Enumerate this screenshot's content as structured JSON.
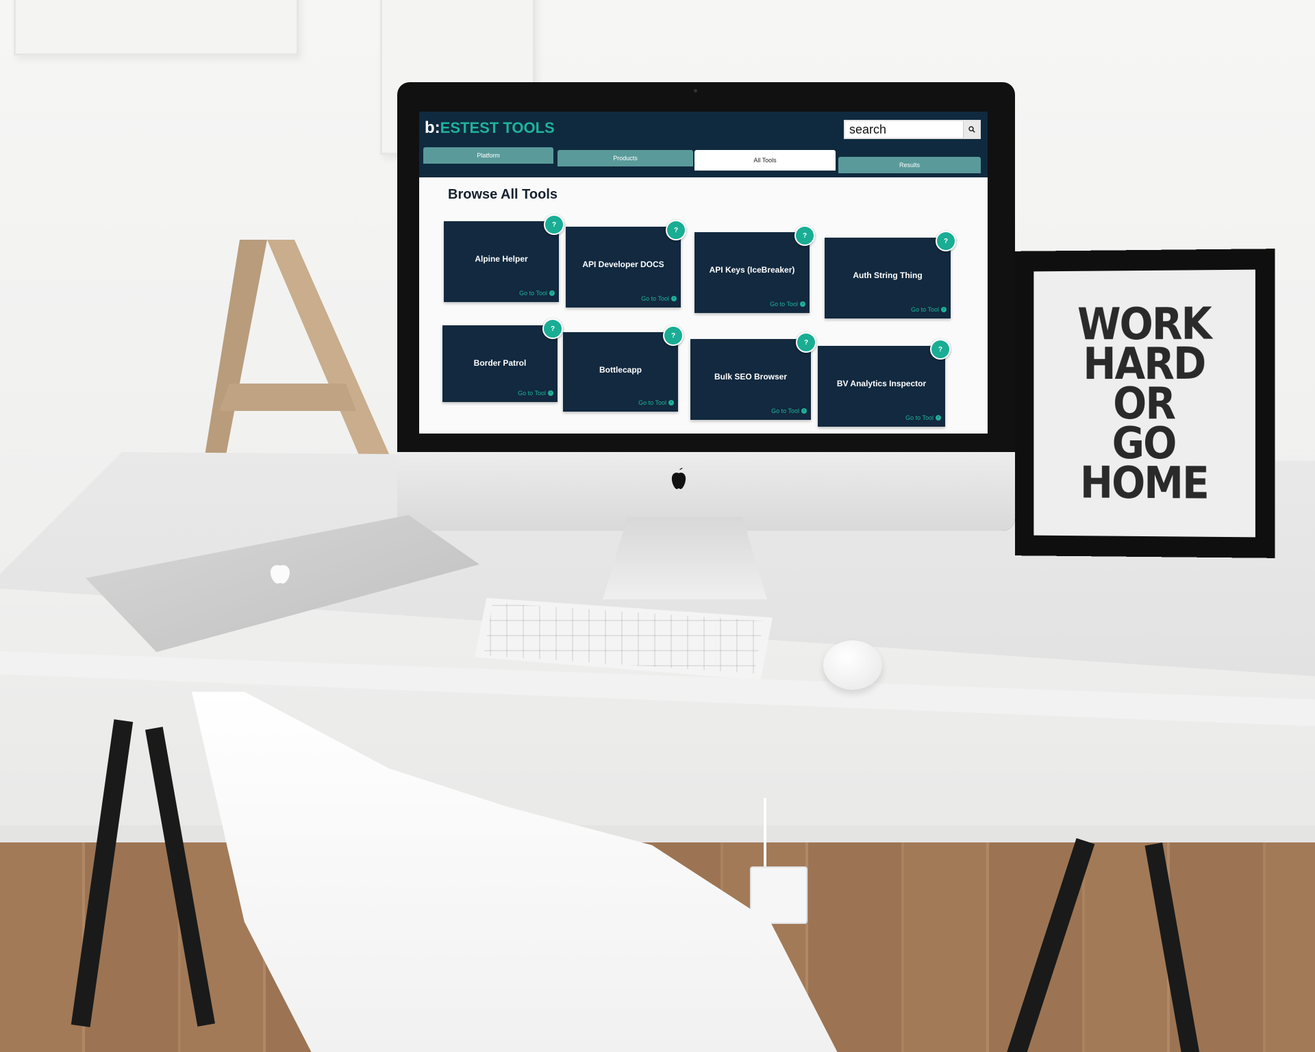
{
  "app": {
    "logo": {
      "b": "b:",
      "text": "ESTEST TOOLS"
    },
    "search": {
      "placeholder": "search",
      "button_icon": "search-icon"
    },
    "tabs": [
      {
        "label": "Platform",
        "active": false
      },
      {
        "label": "Products",
        "active": false
      },
      {
        "label": "All Tools",
        "active": true
      },
      {
        "label": "Results",
        "active": false
      }
    ],
    "page_title": "Browse All Tools",
    "cards": [
      {
        "title": "Alpine Helper",
        "link": "Go to Tool",
        "help": "?"
      },
      {
        "title": "API Developer DOCS",
        "link": "Go to Tool",
        "help": "?"
      },
      {
        "title": "API Keys (IceBreaker)",
        "link": "Go to Tool",
        "help": "?"
      },
      {
        "title": "Auth String Thing",
        "link": "Go to Tool",
        "help": "?"
      },
      {
        "title": "Border Patrol",
        "link": "Go to Tool",
        "help": "?"
      },
      {
        "title": "Bottlecapp",
        "link": "Go to Tool",
        "help": "?"
      },
      {
        "title": "Bulk SEO Browser",
        "link": "Go to Tool",
        "help": "?"
      },
      {
        "title": "BV Analytics Inspector",
        "link": "Go to Tool",
        "help": "?"
      }
    ]
  },
  "poster": {
    "lines": [
      "WORK",
      "HARD",
      "OR",
      "GO",
      "HOME"
    ]
  },
  "colors": {
    "navy": "#12293f",
    "teal": "#1fb39a",
    "tab_teal": "#5a9a9a"
  }
}
